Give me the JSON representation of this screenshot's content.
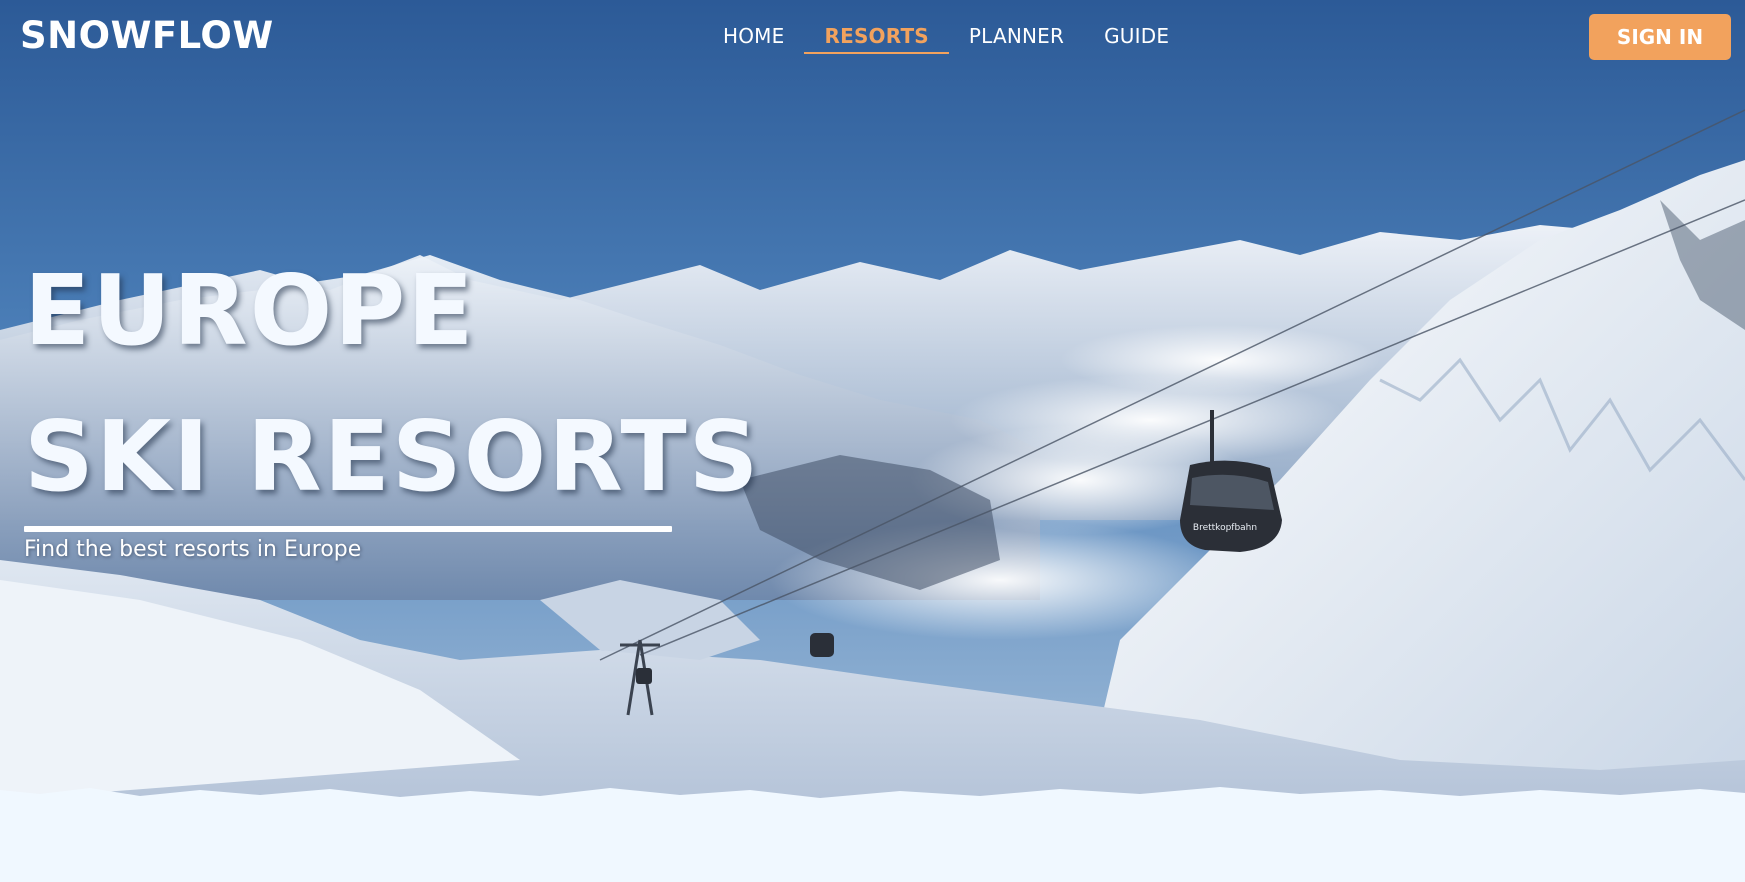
{
  "brand": {
    "name": "SNOWFLOW"
  },
  "nav": {
    "items": [
      {
        "label": "HOME",
        "active": false
      },
      {
        "label": "RESORTS",
        "active": true
      },
      {
        "label": "PLANNER",
        "active": false
      },
      {
        "label": "GUIDE",
        "active": false
      }
    ]
  },
  "header": {
    "sign_in_label": "SIGN IN"
  },
  "hero": {
    "title_line1": "EUROPE",
    "title_line2": "SKI RESORTS",
    "subtitle": "Find the best resorts in Europe",
    "gondola_text": "Brettkopfbahn"
  },
  "colors": {
    "accent": "#f2a25d",
    "sky": "#3d73ad",
    "page_background": "#f0f8ff"
  }
}
